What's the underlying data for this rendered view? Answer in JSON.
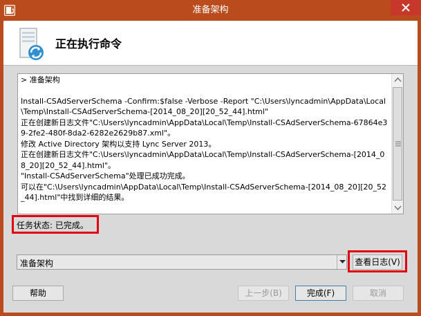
{
  "window": {
    "title": "准备架构",
    "icon": "installer-app-icon",
    "close_icon": "close-icon"
  },
  "header": {
    "title": "正在执行命令",
    "icon": "server-sync-icon"
  },
  "log": {
    "lines": [
      "> 准备架构",
      "",
      "Install-CSAdServerSchema -Confirm:$false -Verbose -Report \"C:\\Users\\lyncadmin\\AppData\\Local\\Temp\\Install-CSAdServerSchema-[2014_08_20][20_52_44].html\"",
      "正在创建新日志文件\"C:\\Users\\lyncadmin\\AppData\\Local\\Temp\\Install-CSAdServerSchema-67864e39-2fe2-480f-8da2-6282e2629b87.xml\"。",
      "修改 Active Directory 架构以支持 Lync Server 2013。",
      "正在创建新日志文件\"C:\\Users\\lyncadmin\\AppData\\Local\\Temp\\Install-CSAdServerSchema-[2014_08_20][20_52_44].html\"。",
      "\"Install-CSAdServerSchema\"处理已成功完成。",
      "可以在\"C:\\Users\\lyncadmin\\AppData\\Local\\Temp\\Install-CSAdServerSchema-[2014_08_20][20_52_44].html\"中找到详细的结果。"
    ]
  },
  "status": {
    "text": "任务状态: 已完成。"
  },
  "task_select": {
    "selected": "准备架构"
  },
  "buttons": {
    "view_log": "查看日志(V)",
    "help": "帮助",
    "previous": "上一步(B)",
    "finish": "完成(F)",
    "cancel": "取消"
  },
  "colors": {
    "titlebar": "#b94b1d",
    "close_button": "#c7372a",
    "highlight_box": "#e0000f"
  }
}
